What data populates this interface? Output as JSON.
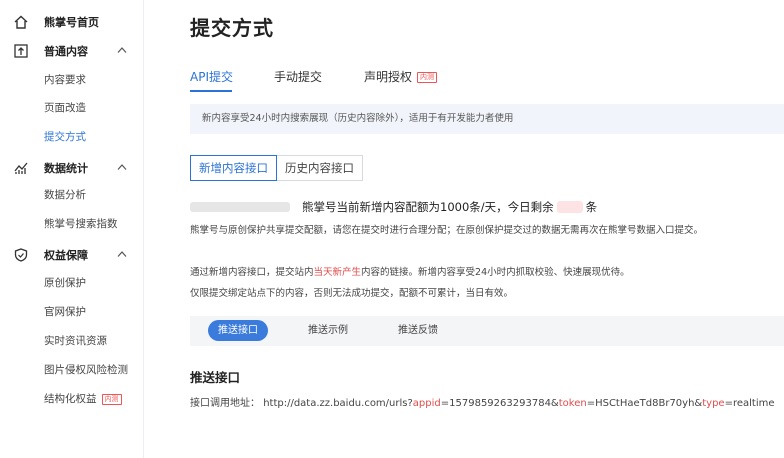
{
  "sidebar": {
    "home": {
      "label": "熊掌号首页",
      "icon": "home-icon"
    },
    "groups": [
      {
        "label": "普通内容",
        "icon": "upload-icon",
        "items": [
          "内容要求",
          "页面改造",
          "提交方式"
        ],
        "active_index": 2
      },
      {
        "label": "数据统计",
        "icon": "stats-icon",
        "items": [
          "数据分析",
          "熊掌号搜索指数"
        ]
      },
      {
        "label": "权益保障",
        "icon": "shield-icon",
        "items": [
          "原创保护",
          "官网保护",
          "实时资讯资源",
          "图片侵权风险检测",
          "结构化权益"
        ],
        "new_tag": "内测"
      }
    ]
  },
  "main": {
    "title": "提交方式",
    "tabs": [
      "API提交",
      "手动提交",
      "声明授权"
    ],
    "tab_tag": "内测",
    "active_tab": 0,
    "notice": "新内容享受24小时内搜索展现（历史内容除外），适用于有开发能力者使用",
    "segments": [
      "新增内容接口",
      "历史内容接口"
    ],
    "quota_before": "熊掌号当前新增内容配额为1000条/天，今日剩余",
    "quota_after": "条",
    "para1": "熊掌号与原创保护共享提交配额，请您在提交时进行合理分配；在原创保护提交过的数据无需再次在熊掌号数据入口提交。",
    "para2_a": "通过新增内容接口，提交站内",
    "para2_red": "当天新产生",
    "para2_b": "内容的链接。新增内容享受24小时内抓取校验、快速展现优待。",
    "para3": "仅限提交绑定站点下的内容，否则无法成功提交，配额不可累计，当日有效。",
    "subtabs": [
      "推送接口",
      "推送示例",
      "推送反馈"
    ],
    "section_title": "推送接口",
    "api": {
      "label": "接口调用地址：",
      "url_base": "http://data.zz.baidu.com/urls?",
      "k1": "appid",
      "v1": "=1579859263293784&",
      "k2": "token",
      "v2": "=HSCtHaeTd8Br70yh&",
      "k3": "type",
      "v3": "=realtime"
    }
  },
  "colors": {
    "accent": "#2b73d6",
    "red": "#e04d4d",
    "notice_bg": "#f1f5fb"
  }
}
